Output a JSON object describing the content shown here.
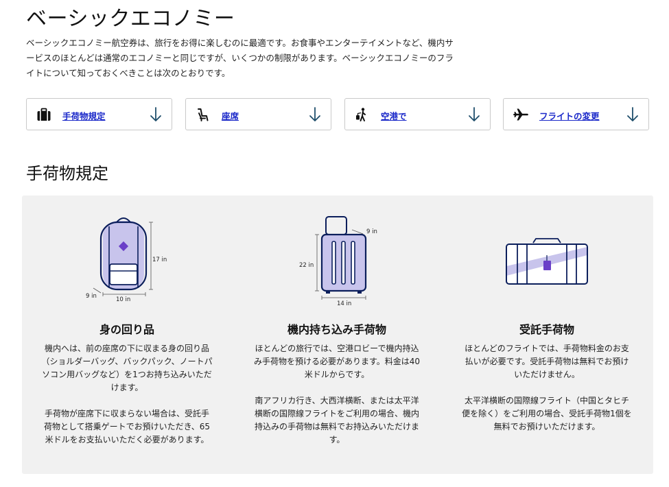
{
  "page": {
    "title": "ベーシックエコノミー",
    "intro": "ベーシックエコノミー航空券は、旅行をお得に楽しむのに最適です。お食事やエンターテイメントなど、機内サービスのほとんどは通常のエコノミーと同じですが、いくつかの制限があります。ベーシックエコノミーのフライトについて知っておくべきことは次のとおりです。"
  },
  "nav": [
    {
      "label": "手荷物規定",
      "icon": "suitcase-icon"
    },
    {
      "label": "座席",
      "icon": "seat-icon"
    },
    {
      "label": "空港で",
      "icon": "traveler-icon"
    },
    {
      "label": "フライトの変更",
      "icon": "airplane-icon"
    }
  ],
  "section": {
    "title": "手荷物規定"
  },
  "columns": [
    {
      "title": "身の回り品",
      "paragraphs": [
        "機内へは、前の座席の下に収まる身の回り品（ショルダーバッグ、バックパック、ノートパソコン用バッグなど）を1つお持ち込みいただけます。",
        "手荷物が座席下に収まらない場合は、受託手荷物として搭乗ゲートでお預けいただき、65米ドルをお支払いいただく必要があります。"
      ],
      "dims": {
        "height": "17 in",
        "width": "10 in",
        "depth": "9 in"
      }
    },
    {
      "title": "機内持ち込み手荷物",
      "paragraphs": [
        "ほとんどの旅行では、空港ロビーで機内持込み手荷物を預ける必要があります。料金は40米ドルからです。",
        "南アフリカ行き、大西洋横断、または太平洋横断の国際線フライトをご利用の場合、機内持込みの手荷物は無料でお持込みいただけます。"
      ],
      "dims": {
        "height": "22 in",
        "width": "14 in",
        "depth": "9 in"
      }
    },
    {
      "title": "受託手荷物",
      "paragraphs": [
        "ほとんどのフライトでは、手荷物料金のお支払いが必要です。受託手荷物は無料でお預けいただけません。",
        "太平洋横断の国際線フライト（中国とタヒチ便を除く）をご利用の場合、受託手荷物1個を無料でお預けいただけます。"
      ]
    }
  ],
  "colors": {
    "link": "#1a28c9",
    "navy": "#0b1e5b",
    "accent_purple": "#6a3fc8",
    "light_purple": "#c8c4ec",
    "teal_arrow": "#1f4e6b",
    "panel_bg": "#f1f1f1"
  }
}
